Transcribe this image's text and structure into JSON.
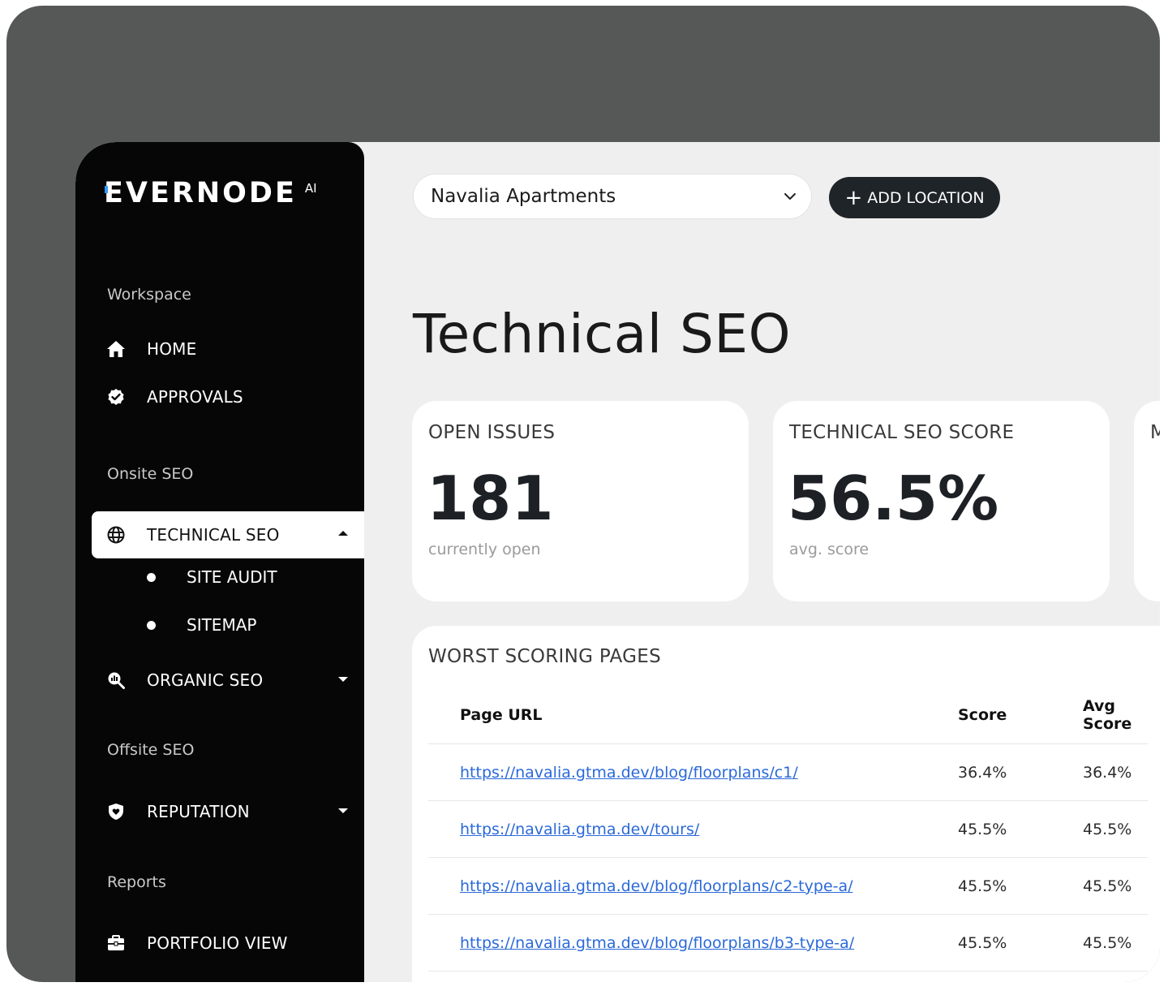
{
  "brand": {
    "name": "EVERNODE",
    "suffix": "AI"
  },
  "sidebar": {
    "sections": {
      "workspace": "Workspace",
      "onsite": "Onsite SEO",
      "offsite": "Offsite SEO",
      "reports": "Reports"
    },
    "items": {
      "home": "HOME",
      "approvals": "APPROVALS",
      "technical_seo": "TECHNICAL SEO",
      "site_audit": "SITE AUDIT",
      "sitemap": "SITEMAP",
      "organic_seo": "ORGANIC SEO",
      "reputation": "REPUTATION",
      "portfolio_view": "PORTFOLIO VIEW"
    }
  },
  "header": {
    "location": "Navalia Apartments",
    "add_location": "ADD LOCATION"
  },
  "page": {
    "title": "Technical SEO"
  },
  "kpis": [
    {
      "title": "OPEN ISSUES",
      "value": "181",
      "sub": "currently open"
    },
    {
      "title": "TECHNICAL SEO SCORE",
      "value": "56.5%",
      "sub": "avg. score"
    },
    {
      "title": "M"
    }
  ],
  "table": {
    "title": "WORST SCORING PAGES",
    "columns": [
      "Page URL",
      "Score",
      "Avg Score"
    ],
    "rows": [
      {
        "url": "https://navalia.gtma.dev/blog/floorplans/c1/",
        "score": "36.4%",
        "avg": "36.4%"
      },
      {
        "url": "https://navalia.gtma.dev/tours/",
        "score": "45.5%",
        "avg": "45.5%"
      },
      {
        "url": "https://navalia.gtma.dev/blog/floorplans/c2-type-a/",
        "score": "45.5%",
        "avg": "45.5%"
      },
      {
        "url": "https://navalia.gtma.dev/blog/floorplans/b3-type-a/",
        "score": "45.5%",
        "avg": "45.5%"
      }
    ]
  },
  "colors": {
    "sidebar_bg": "#060606",
    "content_bg": "#efefef",
    "outer_bg": "#565858",
    "button_bg": "#1f2429",
    "link": "#2a69d8",
    "brand_accent": "#2f9bff"
  },
  "icons": {
    "home": "home-icon",
    "approvals": "check-badge-icon",
    "technical_seo": "globe-icon",
    "organic_seo": "search-chart-icon",
    "reputation": "shield-heart-icon",
    "portfolio_view": "briefcase-icon"
  }
}
